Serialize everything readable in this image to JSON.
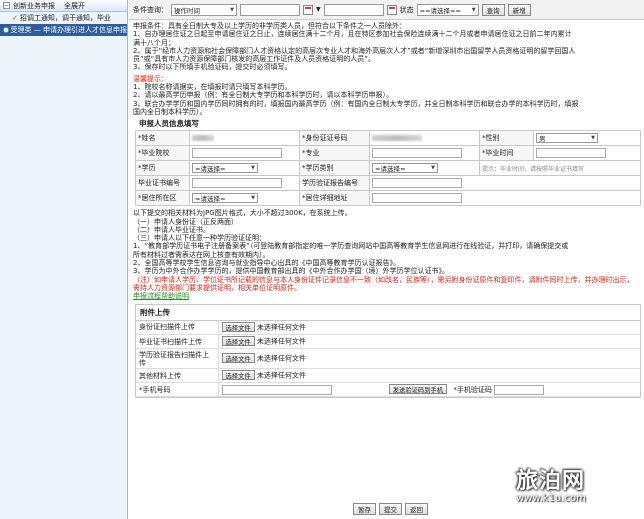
{
  "sidebar": {
    "top_tab": "创新业务申报",
    "top_tab2": "全展开",
    "items": [
      {
        "label": "招调工通知，调干通知，毕业"
      },
      {
        "label": "受理类 — 申请办理引进人才信息申报"
      }
    ]
  },
  "search": {
    "condition_label": "条件查询：",
    "field_option": "操作时间",
    "status_label": "状态",
    "status_option": "==请选择==",
    "query_btn": "查询",
    "add_btn": "新增"
  },
  "intro": {
    "l1": "申报条件：具有全日制大专及以上学历的非学历类人员，但符合以下条件之一人员除外：",
    "l2": "1、自办理居住证之日起至申请居住证之日止，连续居住满十二个月，且在特区参加社会保险连续满十二个月或者申请居住证之日前二年内累计",
    "l2b": "满十八个月；",
    "l3": "2、属于“经市人力资源和社会保障部门人才资格认定的高层次专业人才和海外高层次人才”或者“新增深圳市出国留学人员资格证明的留学回国人",
    "l3b": "员”或“具有市人力资源保障部门核发的高层工作证件及人员资格证明的人员”。",
    "l4": "3、保存时以下所填手机验证码，提交时必须填写。"
  },
  "tips": {
    "title": "温馨提示：",
    "t1": "1、院校名称请据实，在填报时请只填写本科学历。",
    "t2": "2、请以最高学历申报（例：有全日制大专学历和本科学历时，请以本科学历申报）。",
    "t3": "3、联合办学学历和国内学历同时拥有的时，填报国内最高学历（例：有国内全日制大专学历，并全日制本科学历和联合办学的本科学历时，填报",
    "t3b": "国内全日制本科学历）。"
  },
  "form": {
    "title": "申报人员信息填写",
    "name_label": "*姓名",
    "id_label": "*身份证证号码",
    "gender_label": "*性别",
    "gender_option": "男",
    "school_label": "*毕业院校",
    "major_label": "*专业",
    "grad_time_label": "*毕业时间",
    "degree_label": "*学历",
    "degree_option": "=请选择=",
    "degree_type_label": "*学历类别",
    "degree_type_option": "=请选择=",
    "hint": "提示：毕业时间，请按照毕业证书填写",
    "cert_label": "毕业证书编号",
    "verify_label": "学历验证报告编号",
    "district_label": "*居住所在区",
    "district_option": "=请选择=",
    "addr_label": "*居住详细地址"
  },
  "upload_notes": {
    "n0": "以下提交的相关材料为JPG图片格式，大小不超过300K，在系统上传。",
    "n1": "（一）申请人身份证（正反两面）",
    "n2": "（二）申请人毕业证书。",
    "n3": "（三）申请人以下任意一种学历验证证明：",
    "n4": "1、“教育部学历证书电子注册备案表”（可登陆教育部指定的唯一学历查询网站中国高等教育学生信息网进行在线验证，并打印，请确保提交或",
    "n4b": "所有材料过者需表达在网上核查有效期内）。",
    "n5": "2、全国高等学校学生信息咨询与就业指导中心出具的《中国高等教育学历认证报告》。",
    "n6": "3、学历为中外合作办学学历的，提供中国教育部出具的《中外合作办学国（境）外学历学位认证书》。",
    "red1": "（注）如申请人学历、学位证书所记载的信息与本人身份证件记录信息不一致（如改名，民族等），需另附身份证原件和复印件，请附件同时上传，并办理时出示，",
    "red2": "需持人力资源部门要求提供证明，相关单位证明原件。",
    "green": "申报流程帮助说明"
  },
  "upload": {
    "title": "附件上传",
    "rows": [
      {
        "label": "身份证扫描件上传",
        "btn": "选择文件",
        "status": "未选择任何文件"
      },
      {
        "label": "毕业证书扫描件上传",
        "btn": "选择文件",
        "status": "未选择任何文件"
      },
      {
        "label": "学历验证报告扫描件上传",
        "btn": "选择文件",
        "status": "未选择任何文件"
      },
      {
        "label": "其他材料上传",
        "btn": "选择文件",
        "status": "未选择任何文件"
      }
    ],
    "phone_label": "*手机号码",
    "send_code_btn": "发送验证码到手机",
    "code_label": "*手机验证码"
  },
  "actions": {
    "save": "暂存",
    "submit": "提交",
    "back": "返回"
  },
  "watermark": {
    "name": "旅泊网",
    "url": "www.k1u.com"
  }
}
